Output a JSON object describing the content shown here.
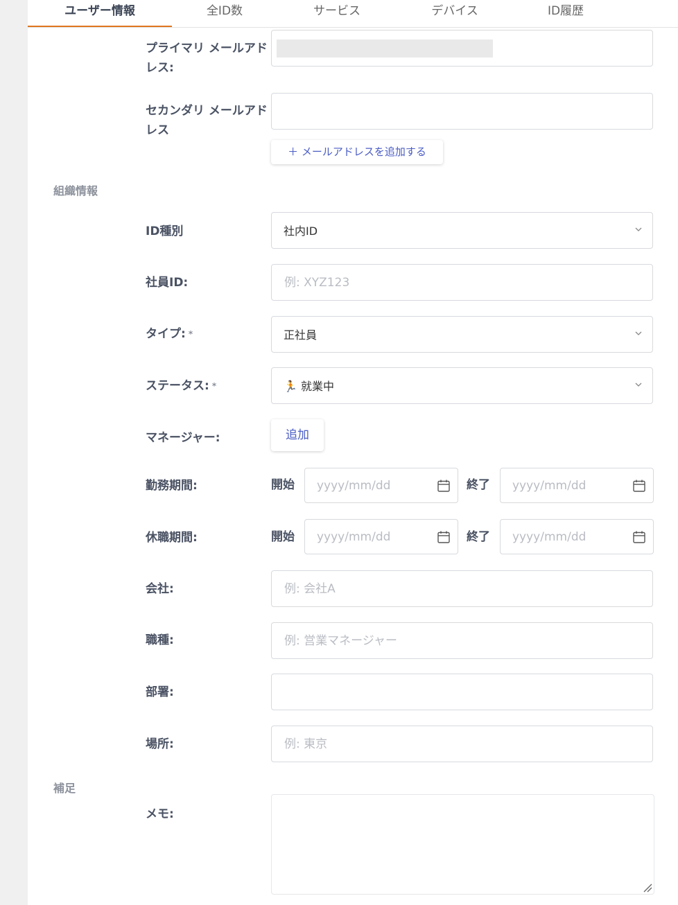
{
  "tabs": [
    {
      "label": "ユーザー情報",
      "active": true
    },
    {
      "label": "全ID数",
      "active": false
    },
    {
      "label": "サービス",
      "active": false
    },
    {
      "label": "デバイス",
      "active": false
    },
    {
      "label": "ID履歴",
      "active": false
    }
  ],
  "email": {
    "primary_label": "プライマリ メールアドレス:",
    "secondary_label": "セカンダリ メールアドレス",
    "add_button": "＋ メールアドレスを追加する"
  },
  "sections": {
    "org": "組織情報",
    "notes": "補足"
  },
  "org": {
    "id_type_label": "ID種別",
    "id_type_value": "社内ID",
    "employee_id_label": "社員ID:",
    "employee_id_placeholder": "例: XYZ123",
    "type_label": "タイプ:",
    "type_value": "正社員",
    "status_label": "ステータス:",
    "status_value": "就業中",
    "status_emoji": "🏃",
    "required_mark": "*",
    "manager_label": "マネージャー:",
    "manager_button": "追加",
    "work_period_label": "勤務期間:",
    "leave_period_label": "休職期間:",
    "start_label": "開始",
    "end_label": "終了",
    "date_placeholder": "yyyy/mm/dd",
    "company_label": "会社:",
    "company_placeholder": "例: 会社A",
    "job_label": "職種:",
    "job_placeholder": "例: 営業マネージャー",
    "dept_label": "部署:",
    "location_label": "場所:",
    "location_placeholder": "例: 東京"
  },
  "notes": {
    "memo_label": "メモ:"
  },
  "colors": {
    "accent": "#e0761f",
    "link": "#4a5cc4"
  }
}
